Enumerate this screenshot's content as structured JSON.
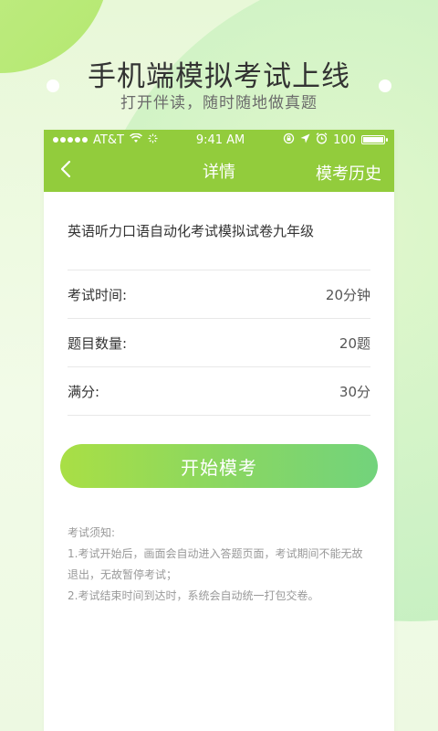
{
  "banner": {
    "headline": "手机端模拟考试上线",
    "subline": "打开伴读，随时随地做真题"
  },
  "status_bar": {
    "carrier": "AT&T",
    "time": "9:41 AM",
    "battery": "100"
  },
  "nav": {
    "back_icon": "chevron-left-icon",
    "title": "详情",
    "right_label": "模考历史"
  },
  "exam": {
    "title": "英语听力口语自动化考试模拟试卷九年级",
    "rows": [
      {
        "label": "考试时间:",
        "value": "20分钟"
      },
      {
        "label": "题目数量:",
        "value": "20题"
      },
      {
        "label": "满分:",
        "value": "30分"
      }
    ],
    "start_label": "开始模考"
  },
  "notes": {
    "title": "考试须知:",
    "lines": [
      "1.考试开始后，画面会自动进入答题页面，考试期间不能无故",
      "退出，无故暂停考试；",
      "2.考试结束时间到达时，系统会自动统一打包交卷。"
    ]
  },
  "colors": {
    "nav_green": "#92cc3c",
    "button_start": "#a9df45",
    "button_end": "#72d37c"
  }
}
